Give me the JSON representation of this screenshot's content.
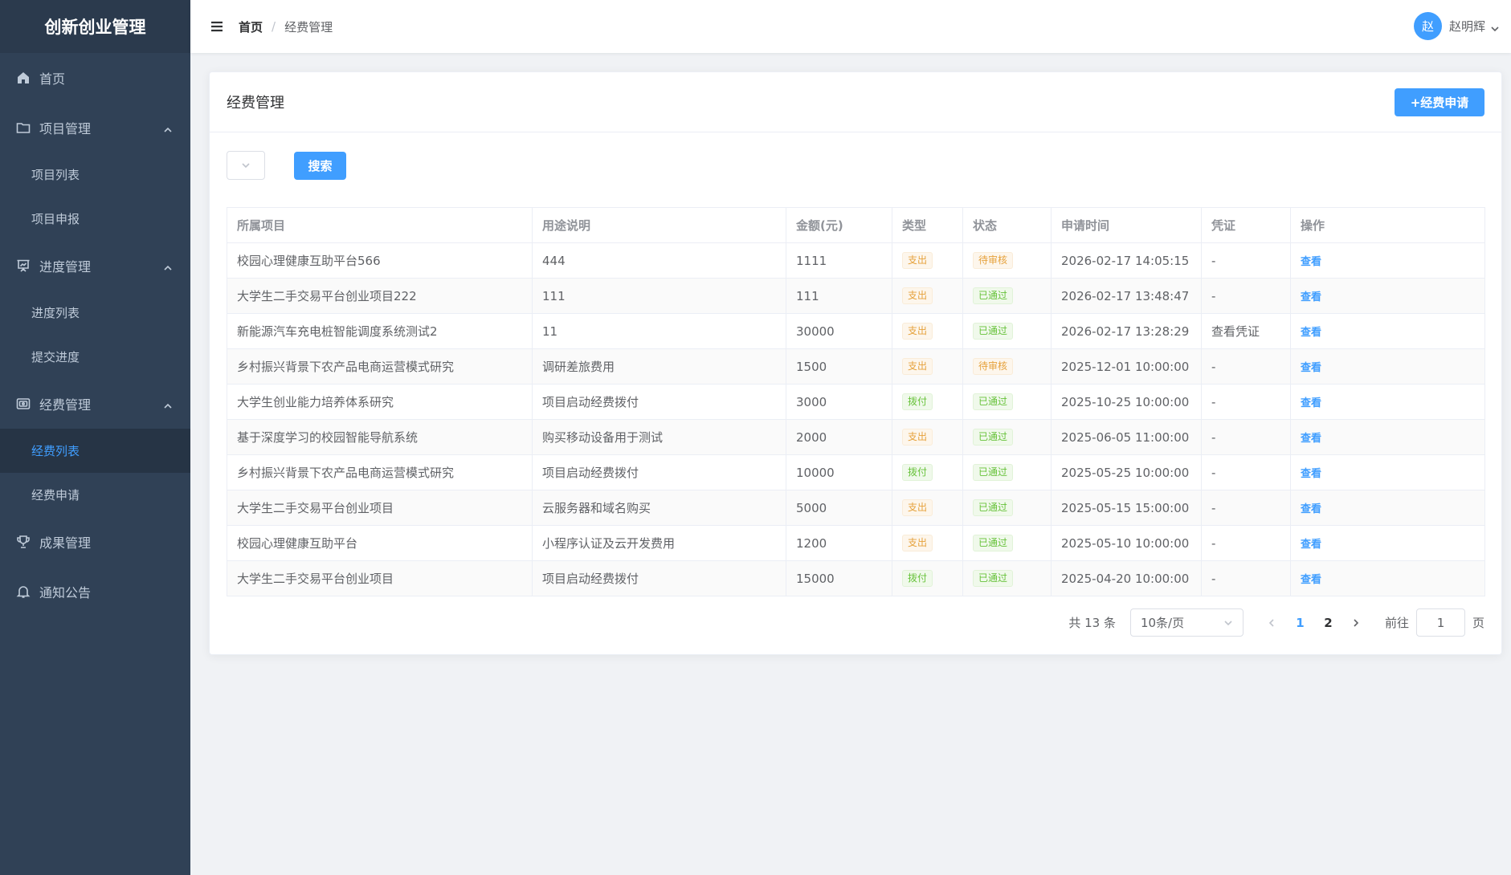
{
  "app": {
    "title": "创新创业管理"
  },
  "sidebar": {
    "items": [
      {
        "label": "首页",
        "icon": "home-icon"
      },
      {
        "label": "项目管理",
        "icon": "folder-icon",
        "children": [
          "项目列表",
          "项目申报"
        ]
      },
      {
        "label": "进度管理",
        "icon": "presentation-icon",
        "children": [
          "进度列表",
          "提交进度"
        ]
      },
      {
        "label": "经费管理",
        "icon": "wallet-icon",
        "children": [
          "经费列表",
          "经费申请"
        ]
      },
      {
        "label": "成果管理",
        "icon": "trophy-icon"
      },
      {
        "label": "通知公告",
        "icon": "bell-icon"
      }
    ],
    "active_sub": "经费列表"
  },
  "header": {
    "breadcrumb": {
      "home": "首页",
      "separator": "/",
      "current": "经费管理"
    },
    "user": {
      "avatar_text": "赵",
      "name": "赵明辉"
    }
  },
  "card": {
    "title": "经费管理",
    "apply_label": "+经费申请",
    "search_label": "搜索"
  },
  "table": {
    "columns": [
      "所属项目",
      "用途说明",
      "金额(元)",
      "类型",
      "状态",
      "申请时间",
      "凭证",
      "操作"
    ],
    "rows": [
      {
        "project": "校园心理健康互助平台566",
        "purpose": "444",
        "amount": "1111",
        "type": "支出",
        "status": "待审核",
        "time": "2026-02-17 14:05:15",
        "voucher": "-",
        "action": "查看"
      },
      {
        "project": "大学生二手交易平台创业项目222",
        "purpose": "111",
        "amount": "111",
        "type": "支出",
        "status": "已通过",
        "time": "2026-02-17 13:48:47",
        "voucher": "-",
        "action": "查看"
      },
      {
        "project": "新能源汽车充电桩智能调度系统测试2",
        "purpose": "11",
        "amount": "30000",
        "type": "支出",
        "status": "已通过",
        "time": "2026-02-17 13:28:29",
        "voucher": "查看凭证",
        "action": "查看"
      },
      {
        "project": "乡村振兴背景下农产品电商运营模式研究",
        "purpose": "调研差旅费用",
        "amount": "1500",
        "type": "支出",
        "status": "待审核",
        "time": "2025-12-01 10:00:00",
        "voucher": "-",
        "action": "查看"
      },
      {
        "project": "大学生创业能力培养体系研究",
        "purpose": "项目启动经费拨付",
        "amount": "3000",
        "type": "拨付",
        "status": "已通过",
        "time": "2025-10-25 10:00:00",
        "voucher": "-",
        "action": "查看"
      },
      {
        "project": "基于深度学习的校园智能导航系统",
        "purpose": "购买移动设备用于测试",
        "amount": "2000",
        "type": "支出",
        "status": "已通过",
        "time": "2025-06-05 11:00:00",
        "voucher": "-",
        "action": "查看"
      },
      {
        "project": "乡村振兴背景下农产品电商运营模式研究",
        "purpose": "项目启动经费拨付",
        "amount": "10000",
        "type": "拨付",
        "status": "已通过",
        "time": "2025-05-25 10:00:00",
        "voucher": "-",
        "action": "查看"
      },
      {
        "project": "大学生二手交易平台创业项目",
        "purpose": "云服务器和域名购买",
        "amount": "5000",
        "type": "支出",
        "status": "已通过",
        "time": "2025-05-15 15:00:00",
        "voucher": "-",
        "action": "查看"
      },
      {
        "project": "校园心理健康互助平台",
        "purpose": "小程序认证及云开发费用",
        "amount": "1200",
        "type": "支出",
        "status": "已通过",
        "time": "2025-05-10 10:00:00",
        "voucher": "-",
        "action": "查看"
      },
      {
        "project": "大学生二手交易平台创业项目",
        "purpose": "项目启动经费拨付",
        "amount": "15000",
        "type": "拨付",
        "status": "已通过",
        "time": "2025-04-20 10:00:00",
        "voucher": "-",
        "action": "查看"
      }
    ]
  },
  "pagination": {
    "total_label": "共 13 条",
    "page_size": "10条/页",
    "pages": [
      "1",
      "2"
    ],
    "current_page": "1",
    "goto_prefix": "前往",
    "goto_value": "1",
    "goto_suffix": "页"
  },
  "colors": {
    "sidebar_bg": "#304156",
    "accent": "#409eff",
    "tag_warning": "#e6a23c",
    "tag_success": "#67c23a"
  }
}
